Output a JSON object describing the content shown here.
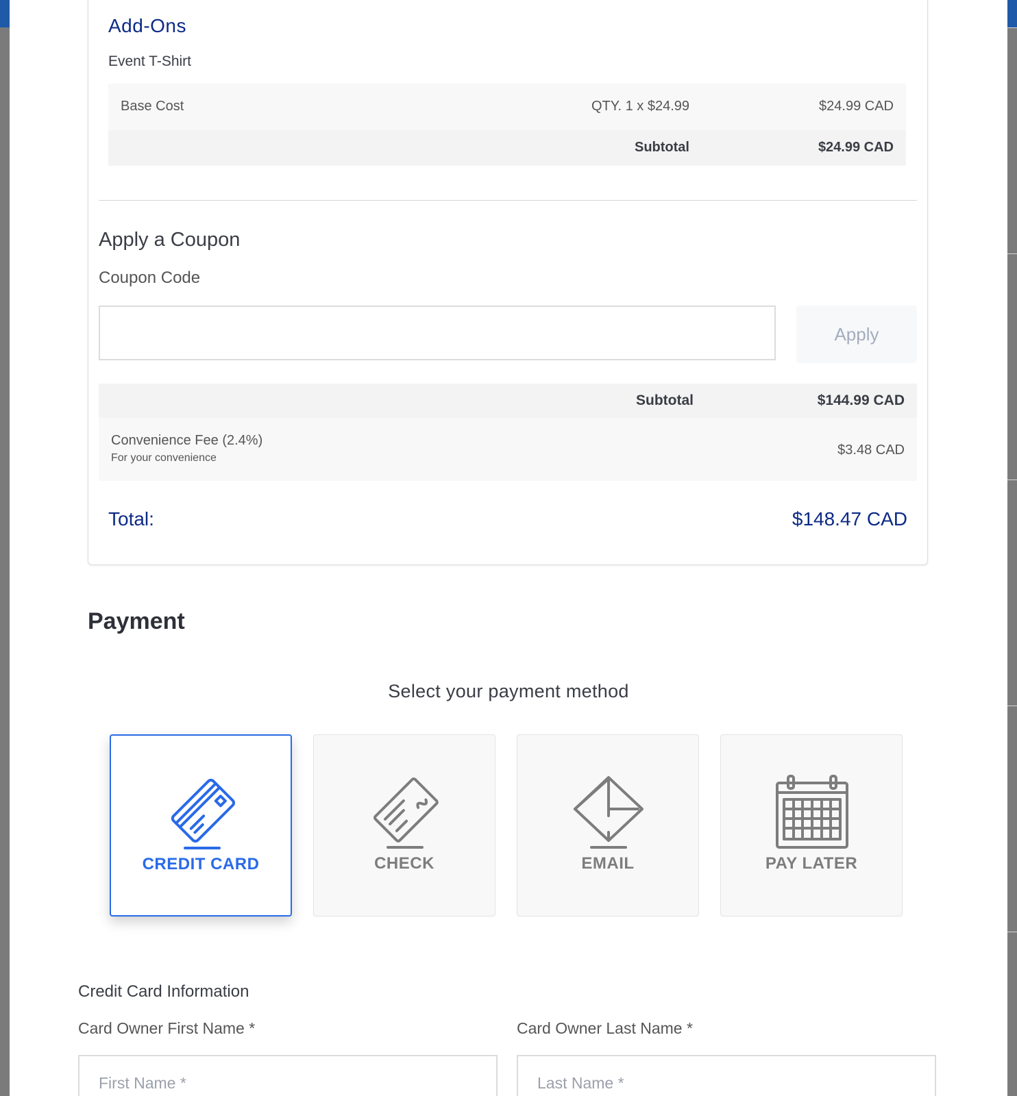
{
  "addons": {
    "title": "Add-Ons",
    "item_name": "Event T-Shirt",
    "base_row": {
      "label": "Base Cost",
      "qty": "QTY. 1 x $24.99",
      "amount": "$24.99 CAD"
    },
    "subtotal_row": {
      "label": "Subtotal",
      "amount": "$24.99 CAD"
    }
  },
  "coupon": {
    "title": "Apply a Coupon",
    "label": "Coupon Code",
    "value": "",
    "apply_label": "Apply"
  },
  "totals": {
    "subtotal_label": "Subtotal",
    "subtotal_amount": "$144.99 CAD",
    "fee_label": "Convenience Fee (2.4%)",
    "fee_note": "For your convenience",
    "fee_amount": "$3.48 CAD",
    "total_label": "Total:",
    "total_amount": "$148.47 CAD"
  },
  "payment": {
    "heading": "Payment",
    "subheading": "Select your payment method",
    "selected": "credit-card",
    "methods": [
      {
        "id": "credit-card",
        "label": "CREDIT CARD",
        "icon": "credit-card-icon"
      },
      {
        "id": "check",
        "label": "CHECK",
        "icon": "check-icon"
      },
      {
        "id": "email",
        "label": "EMAIL",
        "icon": "envelope-icon"
      },
      {
        "id": "pay-later",
        "label": "PAY LATER",
        "icon": "calendar-icon"
      }
    ],
    "accent_color": "#2a6ae8",
    "inactive_color": "#7d7d7d"
  },
  "credit_card": {
    "heading": "Credit Card Information",
    "first_name_label": "Card Owner First Name *",
    "first_name_placeholder": "First Name *",
    "last_name_label": "Card Owner Last Name *",
    "last_name_placeholder": "Last Name *"
  },
  "colors": {
    "brand_navy": "#0c2a86",
    "header_blue": "#1f5aa8"
  }
}
